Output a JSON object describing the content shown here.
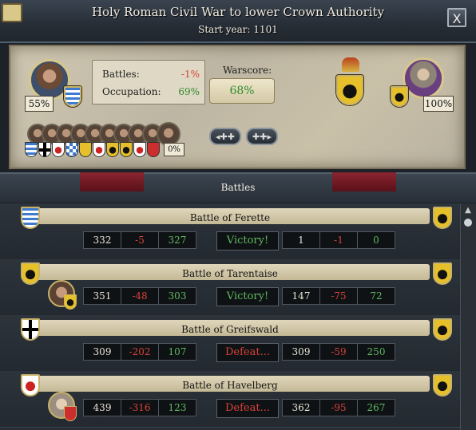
{
  "window": {
    "title": "Holy Roman Civil War to lower Crown Authority",
    "start_year": "Start year: 1101",
    "close_label": "X"
  },
  "summary": {
    "attacker_percent": "55%",
    "defender_percent": "100%",
    "battles_label": "Battles:",
    "battles_value": "-1%",
    "occupation_label": "Occupation:",
    "occupation_value": "69%",
    "warscore_label": "Warscore:",
    "warscore_value": "68%",
    "ally_percent": "0%",
    "prev_label": "◂✚✚",
    "next_label": "✚✚▸"
  },
  "battles_header": "Battles",
  "battles": [
    {
      "name": "Battle of Ferette",
      "att": [
        "332",
        "-5",
        "327"
      ],
      "result": "Victory!",
      "def": [
        "1",
        "-1",
        "0"
      ],
      "outcome": "victory"
    },
    {
      "name": "Battle of Tarentaise",
      "att": [
        "351",
        "-48",
        "303"
      ],
      "result": "Victory!",
      "def": [
        "147",
        "-75",
        "72"
      ],
      "outcome": "victory"
    },
    {
      "name": "Battle of Greifswald",
      "att": [
        "309",
        "-202",
        "107"
      ],
      "result": "Defeat...",
      "def": [
        "309",
        "-59",
        "250"
      ],
      "outcome": "defeat"
    },
    {
      "name": "Battle of Havelberg",
      "att": [
        "439",
        "-316",
        "123"
      ],
      "result": "Defeat...",
      "def": [
        "362",
        "-95",
        "267"
      ],
      "outcome": "defeat"
    }
  ],
  "colors": {
    "victory": "#5fb860",
    "defeat": "#d8423a",
    "parchment": "#c9c0a8",
    "panel": "#272d33"
  }
}
